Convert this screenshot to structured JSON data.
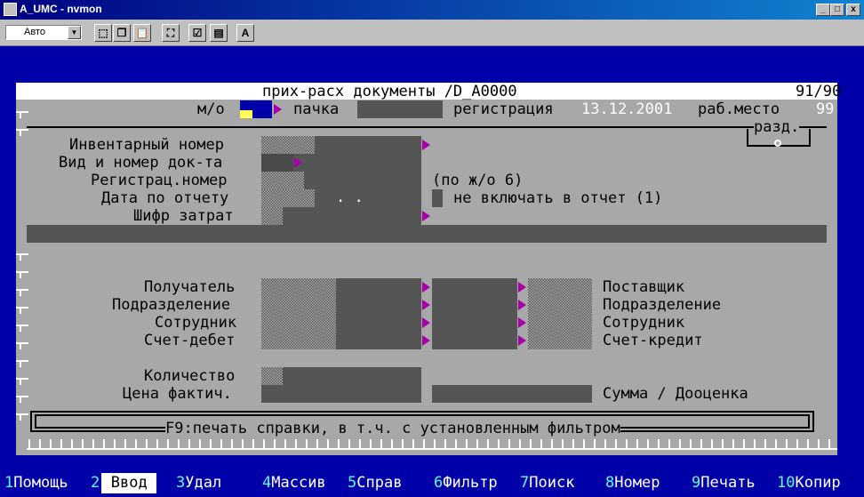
{
  "window": {
    "title": "A_UMC - nvmon",
    "min": "_",
    "max": "□",
    "close": "x"
  },
  "toolbar": {
    "font_select": "Авто",
    "bold_a": "A"
  },
  "header": {
    "title": "прих-расх документы /D_A0000",
    "page_count": "91/90"
  },
  "row2": {
    "mo_label": "м/о",
    "pachka_label": "пачка",
    "reg_label": "регистрация",
    "reg_date": "13.12.2001",
    "rab_label": "раб.место",
    "rab_value": "99"
  },
  "razd": "разд.",
  "fields": {
    "inventory": "Инвентарный номер",
    "doc_type": "Вид и номер док-та",
    "reg_number": "Регистрац.номер",
    "report_date": "Дата по отчету",
    "cost_code": "Шифр затрат",
    "po_note": "(по ж/о 6)",
    "date_dots": ". .",
    "exclude": "не включать в отчет (1)"
  },
  "left_labels": [
    "Получатель",
    "Подразделение",
    "Сотрудник",
    "Счет-дебет"
  ],
  "right_labels": [
    "Поставщик",
    "Подразделение",
    "Сотрудник",
    "Счет-кредит"
  ],
  "quantity": "Количество",
  "price": "Цена фактич.",
  "sum": "Сумма / Дооценка",
  "status_message": "F9:печать справки, в т.ч. с установленным фильтром",
  "menu": [
    {
      "num": "1",
      "label": "Помощь"
    },
    {
      "num": "2",
      "label": " Ввод "
    },
    {
      "num": "3",
      "label": "Удал"
    },
    {
      "num": "4",
      "label": "Массив"
    },
    {
      "num": "5",
      "label": "Справ"
    },
    {
      "num": "6",
      "label": "Фильтр"
    },
    {
      "num": "7",
      "label": "Поиск"
    },
    {
      "num": "8",
      "label": "Номер"
    },
    {
      "num": "9",
      "label": "Печать"
    },
    {
      "num": "10",
      "label": "Копир"
    }
  ]
}
